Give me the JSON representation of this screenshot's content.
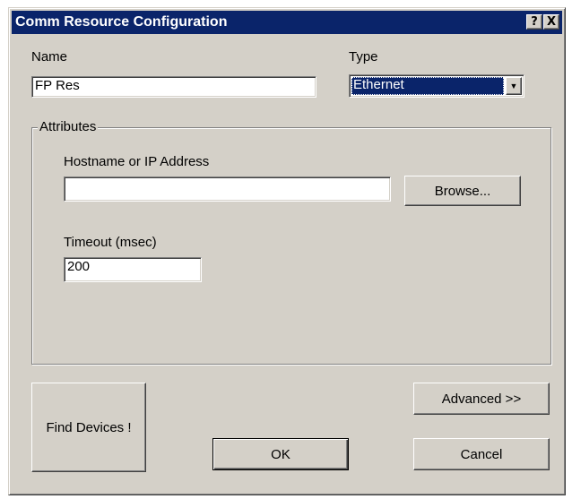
{
  "window": {
    "title": "Comm Resource Configuration",
    "help_button": "?",
    "close_button": "X"
  },
  "name": {
    "label": "Name",
    "value": "FP Res"
  },
  "type": {
    "label": "Type",
    "value": "Ethernet",
    "dropdown_icon": "chevron-down-icon"
  },
  "attributes": {
    "group_label": "Attributes",
    "hostname_label": "Hostname or IP Address",
    "hostname_value": "",
    "browse_label": "Browse...",
    "timeout_label": "Timeout (msec)",
    "timeout_value": "200"
  },
  "buttons": {
    "find_devices": "Find Devices !",
    "advanced": "Advanced  >>",
    "ok": "OK",
    "cancel": "Cancel"
  },
  "colors": {
    "titlebar": "#0a246a",
    "dialog_face": "#d4d0c8",
    "selection": "#0a246a"
  }
}
